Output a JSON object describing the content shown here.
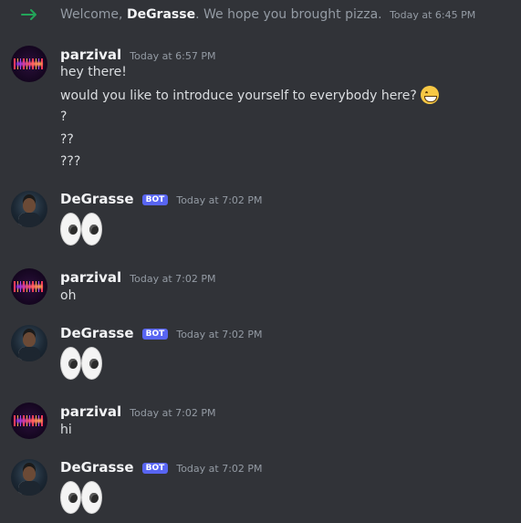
{
  "system": {
    "prefix": "Welcome, ",
    "user": "DeGrasse",
    "suffix": ". We hope you brought pizza.",
    "timestamp": "Today at 6:45 PM"
  },
  "colors": {
    "background": "#313338",
    "arrow": "#23a559",
    "bot_badge": "#5865f2"
  },
  "messages": [
    {
      "author": "parzival",
      "timestamp": "Today at 6:57 PM",
      "lines": [
        "hey there!",
        "would you like to introduce yourself to everybody here?",
        "?",
        "??",
        "???"
      ],
      "emoji": "grinning-face-emoji"
    },
    {
      "author": "DeGrasse",
      "bot_badge": "BOT",
      "timestamp": "Today at 7:02 PM",
      "emoji": "eyes-emoji"
    },
    {
      "author": "parzival",
      "timestamp": "Today at 7:02 PM",
      "lines": [
        "oh"
      ]
    },
    {
      "author": "DeGrasse",
      "bot_badge": "BOT",
      "timestamp": "Today at 7:02 PM",
      "emoji": "eyes-emoji"
    },
    {
      "author": "parzival",
      "timestamp": "Today at 7:02 PM",
      "lines": [
        "hi"
      ]
    },
    {
      "author": "DeGrasse",
      "bot_badge": "BOT",
      "timestamp": "Today at 7:02 PM",
      "emoji": "eyes-emoji"
    }
  ]
}
